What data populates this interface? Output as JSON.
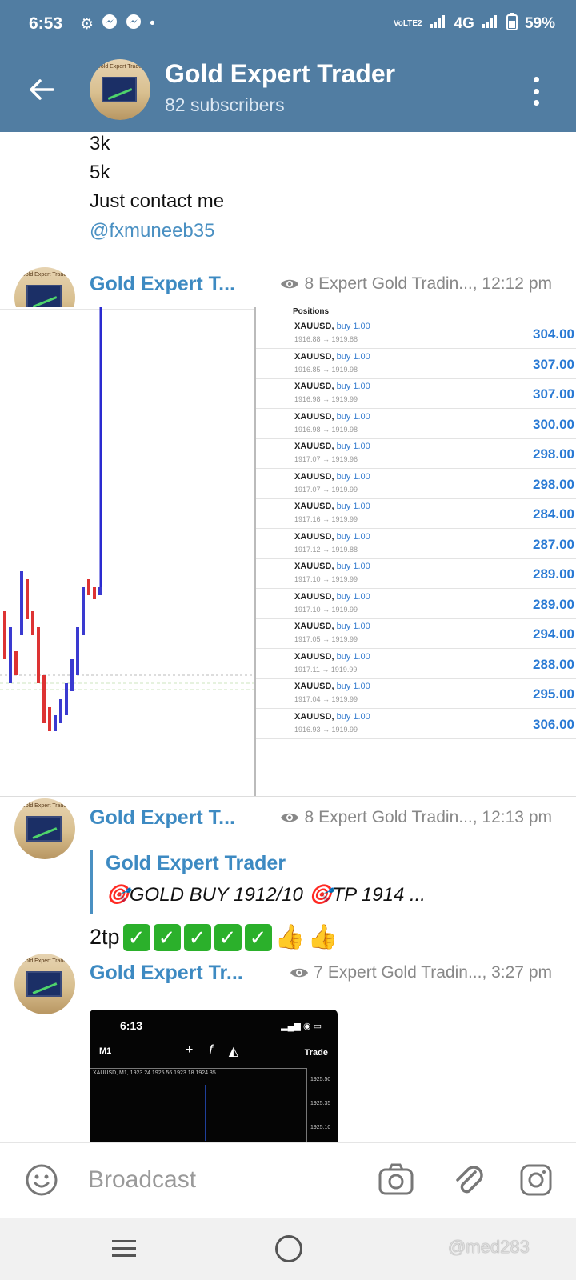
{
  "status_bar": {
    "time": "6:53",
    "volte": "VoLTE2",
    "network": "4G",
    "battery": "59%"
  },
  "header": {
    "title": "Gold Expert Trader",
    "subtitle": "82 subscribers"
  },
  "messages": {
    "first": {
      "lines": [
        "3k",
        "5k",
        "Just contact me"
      ],
      "link": "@fxmuneeb35"
    },
    "post1": {
      "sender": "Gold Expert T...",
      "views": "8",
      "signature": "Expert Gold Tradin..., 12:12 pm",
      "positions_title": "Positions",
      "positions": [
        {
          "symbol": "XAUUSD,",
          "side": "buy 1.00",
          "prices": "1916.88 → 1919.88",
          "profit": "304.00"
        },
        {
          "symbol": "XAUUSD,",
          "side": "buy 1.00",
          "prices": "1916.85 → 1919.98",
          "profit": "307.00"
        },
        {
          "symbol": "XAUUSD,",
          "side": "buy 1.00",
          "prices": "1916.98 → 1919.99",
          "profit": "307.00"
        },
        {
          "symbol": "XAUUSD,",
          "side": "buy 1.00",
          "prices": "1916.98 → 1919.98",
          "profit": "300.00"
        },
        {
          "symbol": "XAUUSD,",
          "side": "buy 1.00",
          "prices": "1917.07 → 1919.96",
          "profit": "298.00"
        },
        {
          "symbol": "XAUUSD,",
          "side": "buy 1.00",
          "prices": "1917.07 → 1919.99",
          "profit": "298.00"
        },
        {
          "symbol": "XAUUSD,",
          "side": "buy 1.00",
          "prices": "1917.16 → 1919.99",
          "profit": "284.00"
        },
        {
          "symbol": "XAUUSD,",
          "side": "buy 1.00",
          "prices": "1917.12 → 1919.88",
          "profit": "287.00"
        },
        {
          "symbol": "XAUUSD,",
          "side": "buy 1.00",
          "prices": "1917.10 → 1919.99",
          "profit": "289.00"
        },
        {
          "symbol": "XAUUSD,",
          "side": "buy 1.00",
          "prices": "1917.10 → 1919.99",
          "profit": "289.00"
        },
        {
          "symbol": "XAUUSD,",
          "side": "buy 1.00",
          "prices": "1917.05 → 1919.99",
          "profit": "294.00"
        },
        {
          "symbol": "XAUUSD,",
          "side": "buy 1.00",
          "prices": "1917.11 → 1919.99",
          "profit": "288.00"
        },
        {
          "symbol": "XAUUSD,",
          "side": "buy 1.00",
          "prices": "1917.04 → 1919.99",
          "profit": "295.00"
        },
        {
          "symbol": "XAUUSD,",
          "side": "buy 1.00",
          "prices": "1916.93 → 1919.99",
          "profit": "306.00"
        }
      ]
    },
    "post2": {
      "sender": "Gold Expert T...",
      "views": "8",
      "signature": "Expert Gold Tradin..., 12:13 pm",
      "reply_name": "Gold Expert Trader",
      "reply_text": "🎯GOLD BUY 1912/10 🎯TP 1914 ...",
      "text": "2tp"
    },
    "post3": {
      "sender": "Gold Expert Tr...",
      "views": "7",
      "signature": "Expert Gold Tradin..., 3:27 pm",
      "shot_time": "6:13",
      "shot_timeframe": "M1",
      "shot_trade": "Trade",
      "shot_info": "XAUUSD, M1, 1923.24 1925.56 1923.18 1924.35",
      "shot_axis": [
        "1925.50",
        "1925.35",
        "1925.10"
      ]
    }
  },
  "composer": {
    "placeholder": "Broadcast"
  },
  "navbar": {
    "watermark": "@med283"
  },
  "colors": {
    "header": "#517da2",
    "sender": "#3d8ac2",
    "link": "#4a90c2"
  }
}
